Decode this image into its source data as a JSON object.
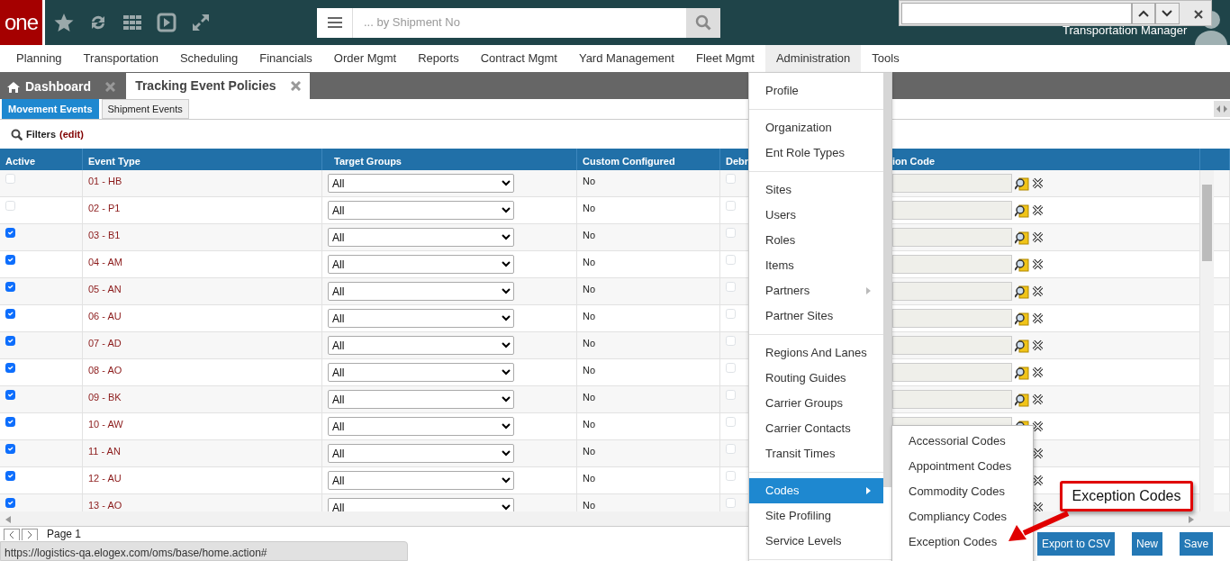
{
  "header": {
    "logo": "one",
    "search": {
      "placeholder": "... by Shipment No"
    },
    "user_role": "Transportation Manager"
  },
  "nav": [
    {
      "label": "Planning",
      "selected": false
    },
    {
      "label": "Transportation",
      "selected": false
    },
    {
      "label": "Scheduling",
      "selected": false
    },
    {
      "label": "Financials",
      "selected": false
    },
    {
      "label": "Order Mgmt",
      "selected": false
    },
    {
      "label": "Reports",
      "selected": false
    },
    {
      "label": "Contract Mgmt",
      "selected": false
    },
    {
      "label": "Yard Management",
      "selected": false
    },
    {
      "label": "Fleet Mgmt",
      "selected": false
    },
    {
      "label": "Administration",
      "selected": true
    },
    {
      "label": "Tools",
      "selected": false
    }
  ],
  "page_tabs": [
    {
      "label": "Dashboard",
      "selected": false,
      "home": true
    },
    {
      "label": "Tracking Event Policies",
      "selected": true,
      "home": false
    }
  ],
  "sub_tabs": [
    {
      "label": "Movement Events",
      "selected": true
    },
    {
      "label": "Shipment Events",
      "selected": false
    }
  ],
  "filters": {
    "label": "Filters",
    "edit": "(edit)"
  },
  "table": {
    "columns": [
      "Active",
      "Event Type",
      "Target Groups",
      "Custom Configured",
      "Debr",
      "ion Code"
    ],
    "rows": [
      {
        "active": false,
        "event_type": "01 - HB",
        "target_groups": "All",
        "custom_configured": "No",
        "debrief": false
      },
      {
        "active": false,
        "event_type": "02 - P1",
        "target_groups": "All",
        "custom_configured": "No",
        "debrief": false
      },
      {
        "active": true,
        "event_type": "03 - B1",
        "target_groups": "All",
        "custom_configured": "No",
        "debrief": false
      },
      {
        "active": true,
        "event_type": "04 - AM",
        "target_groups": "All",
        "custom_configured": "No",
        "debrief": false
      },
      {
        "active": true,
        "event_type": "05 - AN",
        "target_groups": "All",
        "custom_configured": "No",
        "debrief": false
      },
      {
        "active": true,
        "event_type": "06 - AU",
        "target_groups": "All",
        "custom_configured": "No",
        "debrief": false
      },
      {
        "active": true,
        "event_type": "07 - AD",
        "target_groups": "All",
        "custom_configured": "No",
        "debrief": false
      },
      {
        "active": true,
        "event_type": "08 - AO",
        "target_groups": "All",
        "custom_configured": "No",
        "debrief": false
      },
      {
        "active": true,
        "event_type": "09 - BK",
        "target_groups": "All",
        "custom_configured": "No",
        "debrief": false
      },
      {
        "active": true,
        "event_type": "10 - AW",
        "target_groups": "All",
        "custom_configured": "No",
        "debrief": false
      },
      {
        "active": true,
        "event_type": "11 - AN",
        "target_groups": "All",
        "custom_configured": "No",
        "debrief": false
      },
      {
        "active": true,
        "event_type": "12 - AU",
        "target_groups": "All",
        "custom_configured": "No",
        "debrief": false
      },
      {
        "active": true,
        "event_type": "13 - AO",
        "target_groups": "All",
        "custom_configured": "No",
        "debrief": false
      }
    ]
  },
  "pager": {
    "label": "Page 1"
  },
  "buttons": [
    "Export to CSV",
    "New",
    "Save"
  ],
  "status_url": "https://logistics-qa.elogex.com/oms/base/home.action#",
  "admin_menu": {
    "groups": [
      [
        {
          "label": "Profile",
          "selected": false,
          "has_submenu": false
        }
      ],
      [
        {
          "label": "Organization",
          "selected": false,
          "has_submenu": false
        },
        {
          "label": "Ent Role Types",
          "selected": false,
          "has_submenu": false
        }
      ],
      [
        {
          "label": "Sites",
          "selected": false,
          "has_submenu": false
        },
        {
          "label": "Users",
          "selected": false,
          "has_submenu": false
        },
        {
          "label": "Roles",
          "selected": false,
          "has_submenu": false
        },
        {
          "label": "Items",
          "selected": false,
          "has_submenu": false
        },
        {
          "label": "Partners",
          "selected": false,
          "has_submenu": true
        },
        {
          "label": "Partner Sites",
          "selected": false,
          "has_submenu": false
        }
      ],
      [
        {
          "label": "Regions And Lanes",
          "selected": false,
          "has_submenu": false
        },
        {
          "label": "Routing Guides",
          "selected": false,
          "has_submenu": false
        },
        {
          "label": "Carrier Groups",
          "selected": false,
          "has_submenu": false
        },
        {
          "label": "Carrier Contacts",
          "selected": false,
          "has_submenu": false
        },
        {
          "label": "Transit Times",
          "selected": false,
          "has_submenu": false
        }
      ],
      [
        {
          "label": "Codes",
          "selected": true,
          "has_submenu": true
        },
        {
          "label": "Site Profiling",
          "selected": false,
          "has_submenu": false
        },
        {
          "label": "Service Levels",
          "selected": false,
          "has_submenu": false
        }
      ]
    ]
  },
  "codes_submenu": [
    "Accessorial Codes",
    "Appointment Codes",
    "Commodity Codes",
    "Compliancy Codes",
    "Exception Codes"
  ],
  "callout": {
    "text": "Exception Codes"
  }
}
